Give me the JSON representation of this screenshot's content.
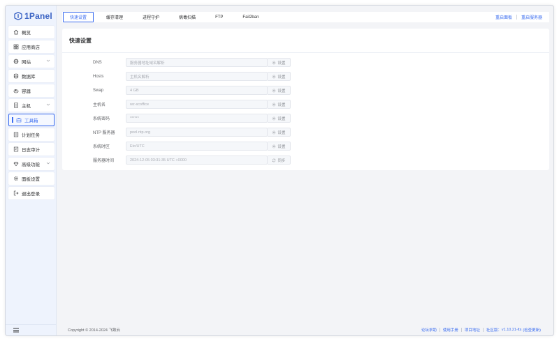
{
  "brand": {
    "name": "1Panel",
    "accent": "#3a6cf0"
  },
  "sidebar": {
    "items": [
      {
        "label": "概览",
        "icon": "home-icon"
      },
      {
        "label": "应用商店",
        "icon": "grid-icon"
      },
      {
        "label": "网站",
        "icon": "globe-icon",
        "expandable": true
      },
      {
        "label": "数据库",
        "icon": "database-icon"
      },
      {
        "label": "容器",
        "icon": "container-icon"
      },
      {
        "label": "主机",
        "icon": "server-icon",
        "expandable": true
      },
      {
        "label": "工具箱",
        "icon": "toolbox-icon",
        "active": true
      },
      {
        "label": "计划任务",
        "icon": "list-icon"
      },
      {
        "label": "日志审计",
        "icon": "log-icon"
      },
      {
        "label": "高级功能",
        "icon": "diamond-icon",
        "expandable": true
      },
      {
        "label": "面板设置",
        "icon": "gear-icon"
      },
      {
        "label": "退出登录",
        "icon": "logout-icon"
      }
    ]
  },
  "topbar": {
    "tabs": [
      "快速设置",
      "缓存清理",
      "进程守护",
      "病毒扫描",
      "FTP",
      "Fail2ban"
    ],
    "active_tab": 0,
    "restart_panel": "重启面板",
    "restart_server": "重启服务器"
  },
  "main": {
    "title": "快速设置",
    "rows": [
      {
        "label": "DNS",
        "value": "服务器地址域名解析",
        "action": "设置",
        "action_icon": "gear-icon"
      },
      {
        "label": "Hosts",
        "value": "主机名解析",
        "action": "设置",
        "action_icon": "gear-icon"
      },
      {
        "label": "Swap",
        "value": "4 GB",
        "action": "设置",
        "action_icon": "gear-icon"
      },
      {
        "label": "主机名",
        "value": "wz-scoffice",
        "action": "设置",
        "action_icon": "gear-icon"
      },
      {
        "label": "系统密码",
        "value": "******",
        "action": "设置",
        "action_icon": "gear-icon"
      },
      {
        "label": "NTP 服务器",
        "value": "pool.ntp.org",
        "action": "设置",
        "action_icon": "gear-icon"
      },
      {
        "label": "系统时区",
        "value": "Etc/UTC",
        "action": "设置",
        "action_icon": "gear-icon"
      },
      {
        "label": "服务器时间",
        "value": "2024-12-05 03:31:35 UTC +0000",
        "action": "同步",
        "action_icon": "sync-icon"
      }
    ]
  },
  "footer": {
    "copyright": "Copyright © 2014-2024 飞致云",
    "links": [
      "论坛求助",
      "使用手册",
      "项目地址"
    ],
    "edition": "社区版：",
    "version": "v1.10.21-lts",
    "check_update": "(检查更新)"
  }
}
